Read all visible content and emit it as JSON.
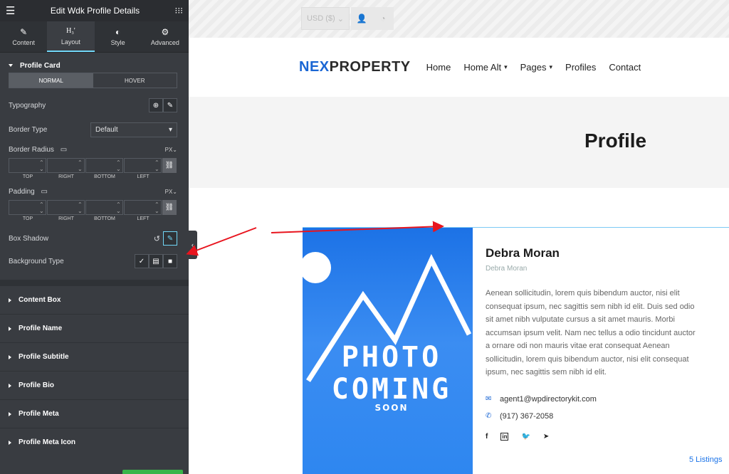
{
  "panel": {
    "title": "Edit Wdk Profile Details",
    "tabs": [
      {
        "label": "Content",
        "icon": "pencil-icon"
      },
      {
        "label": "Layout",
        "icon": "heading-icon"
      },
      {
        "label": "Style",
        "icon": "half-circle-icon"
      },
      {
        "label": "Advanced",
        "icon": "gear-icon"
      }
    ],
    "section_title": "Profile Card",
    "state_tabs": [
      "NORMAL",
      "HOVER"
    ],
    "typography_label": "Typography",
    "border_type_label": "Border Type",
    "border_type_value": "Default",
    "border_radius_label": "Border Radius",
    "padding_label": "Padding",
    "units": "PX",
    "dim_labels": [
      "TOP",
      "RIGHT",
      "BOTTOM",
      "LEFT"
    ],
    "box_shadow_label": "Box Shadow",
    "bg_type_label": "Background Type",
    "sections": [
      "Content Box",
      "Profile Name",
      "Profile Subtitle",
      "Profile Bio",
      "Profile Meta",
      "Profile Meta Icon"
    ]
  },
  "site": {
    "currency": "USD ($)",
    "logo_a": "NEX",
    "logo_b": "PROPERTY",
    "nav": [
      "Home",
      "Home Alt",
      "Pages",
      "Profiles",
      "Contact"
    ],
    "page_title": "Profile",
    "photo_text_1": "PHOTO",
    "photo_text_2": "COMING",
    "photo_text_3": "SOON",
    "profile_name": "Debra Moran",
    "profile_subtitle": "Debra Moran",
    "bio": "Aenean sollicitudin, lorem quis bibendum auctor, nisi elit consequat ipsum, nec sagittis sem nibh id elit. Duis sed odio sit amet nibh vulputate cursus a sit amet mauris. Morbi accumsan ipsum velit. Nam nec tellus a odio tincidunt auctor a ornare odi non mauris vitae erat consequat Aenean sollicitudin, lorem quis bibendum auctor, nisi elit consequat ipsum, nec sagittis sem nibh id elit.",
    "email": "agent1@wpdirectorykit.com",
    "phone": "(917) 367-2058",
    "listings": "5 Listings"
  },
  "colors": {
    "accent": "#1a66d4",
    "annotation": "#e8141e",
    "panel_bg": "#393c41"
  }
}
